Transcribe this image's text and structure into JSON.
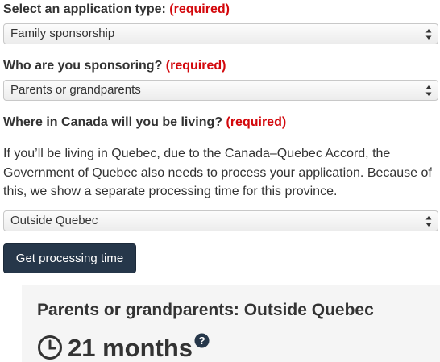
{
  "application_type": {
    "label": "Select an application type:",
    "required": "(required)",
    "value": "Family sponsorship"
  },
  "sponsoring": {
    "label": "Who are you sponsoring?",
    "required": "(required)",
    "value": "Parents or grandparents"
  },
  "location": {
    "label": "Where in Canada will you be living?",
    "required": "(required)",
    "note": "If you’ll be living in Quebec, due to the Canada–Quebec Accord, the Government of Quebec also needs to process your application. Because of this, we show a separate processing time for this province.",
    "value": "Outside Quebec"
  },
  "submit_label": "Get processing time",
  "result": {
    "title": "Parents or grandparents: Outside Quebec",
    "time": "21 months",
    "help_icon": "question-circle-icon",
    "clock_icon": "clock-icon"
  },
  "colors": {
    "required": "#d3080c",
    "button_bg": "#26374a",
    "panel_bg": "#f5f5f5",
    "text": "#333333"
  }
}
